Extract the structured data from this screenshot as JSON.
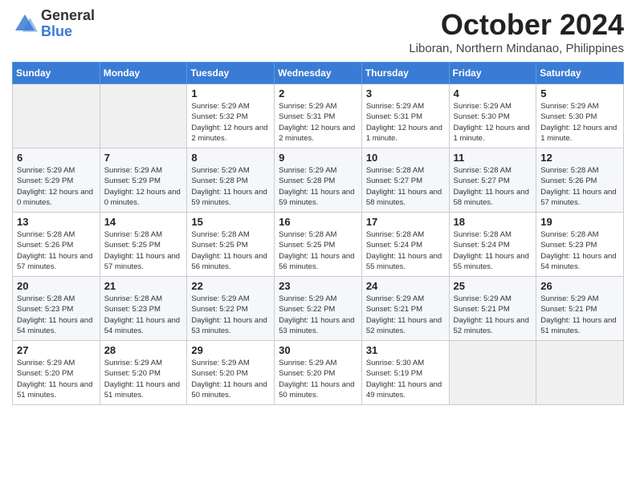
{
  "header": {
    "logo_general": "General",
    "logo_blue": "Blue",
    "month_title": "October 2024",
    "subtitle": "Liboran, Northern Mindanao, Philippines"
  },
  "days_of_week": [
    "Sunday",
    "Monday",
    "Tuesday",
    "Wednesday",
    "Thursday",
    "Friday",
    "Saturday"
  ],
  "weeks": [
    [
      {
        "day": "",
        "sunrise": "",
        "sunset": "",
        "daylight": ""
      },
      {
        "day": "",
        "sunrise": "",
        "sunset": "",
        "daylight": ""
      },
      {
        "day": "1",
        "sunrise": "Sunrise: 5:29 AM",
        "sunset": "Sunset: 5:32 PM",
        "daylight": "Daylight: 12 hours and 2 minutes."
      },
      {
        "day": "2",
        "sunrise": "Sunrise: 5:29 AM",
        "sunset": "Sunset: 5:31 PM",
        "daylight": "Daylight: 12 hours and 2 minutes."
      },
      {
        "day": "3",
        "sunrise": "Sunrise: 5:29 AM",
        "sunset": "Sunset: 5:31 PM",
        "daylight": "Daylight: 12 hours and 1 minute."
      },
      {
        "day": "4",
        "sunrise": "Sunrise: 5:29 AM",
        "sunset": "Sunset: 5:30 PM",
        "daylight": "Daylight: 12 hours and 1 minute."
      },
      {
        "day": "5",
        "sunrise": "Sunrise: 5:29 AM",
        "sunset": "Sunset: 5:30 PM",
        "daylight": "Daylight: 12 hours and 1 minute."
      }
    ],
    [
      {
        "day": "6",
        "sunrise": "Sunrise: 5:29 AM",
        "sunset": "Sunset: 5:29 PM",
        "daylight": "Daylight: 12 hours and 0 minutes."
      },
      {
        "day": "7",
        "sunrise": "Sunrise: 5:29 AM",
        "sunset": "Sunset: 5:29 PM",
        "daylight": "Daylight: 12 hours and 0 minutes."
      },
      {
        "day": "8",
        "sunrise": "Sunrise: 5:29 AM",
        "sunset": "Sunset: 5:28 PM",
        "daylight": "Daylight: 11 hours and 59 minutes."
      },
      {
        "day": "9",
        "sunrise": "Sunrise: 5:29 AM",
        "sunset": "Sunset: 5:28 PM",
        "daylight": "Daylight: 11 hours and 59 minutes."
      },
      {
        "day": "10",
        "sunrise": "Sunrise: 5:28 AM",
        "sunset": "Sunset: 5:27 PM",
        "daylight": "Daylight: 11 hours and 58 minutes."
      },
      {
        "day": "11",
        "sunrise": "Sunrise: 5:28 AM",
        "sunset": "Sunset: 5:27 PM",
        "daylight": "Daylight: 11 hours and 58 minutes."
      },
      {
        "day": "12",
        "sunrise": "Sunrise: 5:28 AM",
        "sunset": "Sunset: 5:26 PM",
        "daylight": "Daylight: 11 hours and 57 minutes."
      }
    ],
    [
      {
        "day": "13",
        "sunrise": "Sunrise: 5:28 AM",
        "sunset": "Sunset: 5:26 PM",
        "daylight": "Daylight: 11 hours and 57 minutes."
      },
      {
        "day": "14",
        "sunrise": "Sunrise: 5:28 AM",
        "sunset": "Sunset: 5:25 PM",
        "daylight": "Daylight: 11 hours and 57 minutes."
      },
      {
        "day": "15",
        "sunrise": "Sunrise: 5:28 AM",
        "sunset": "Sunset: 5:25 PM",
        "daylight": "Daylight: 11 hours and 56 minutes."
      },
      {
        "day": "16",
        "sunrise": "Sunrise: 5:28 AM",
        "sunset": "Sunset: 5:25 PM",
        "daylight": "Daylight: 11 hours and 56 minutes."
      },
      {
        "day": "17",
        "sunrise": "Sunrise: 5:28 AM",
        "sunset": "Sunset: 5:24 PM",
        "daylight": "Daylight: 11 hours and 55 minutes."
      },
      {
        "day": "18",
        "sunrise": "Sunrise: 5:28 AM",
        "sunset": "Sunset: 5:24 PM",
        "daylight": "Daylight: 11 hours and 55 minutes."
      },
      {
        "day": "19",
        "sunrise": "Sunrise: 5:28 AM",
        "sunset": "Sunset: 5:23 PM",
        "daylight": "Daylight: 11 hours and 54 minutes."
      }
    ],
    [
      {
        "day": "20",
        "sunrise": "Sunrise: 5:28 AM",
        "sunset": "Sunset: 5:23 PM",
        "daylight": "Daylight: 11 hours and 54 minutes."
      },
      {
        "day": "21",
        "sunrise": "Sunrise: 5:28 AM",
        "sunset": "Sunset: 5:23 PM",
        "daylight": "Daylight: 11 hours and 54 minutes."
      },
      {
        "day": "22",
        "sunrise": "Sunrise: 5:29 AM",
        "sunset": "Sunset: 5:22 PM",
        "daylight": "Daylight: 11 hours and 53 minutes."
      },
      {
        "day": "23",
        "sunrise": "Sunrise: 5:29 AM",
        "sunset": "Sunset: 5:22 PM",
        "daylight": "Daylight: 11 hours and 53 minutes."
      },
      {
        "day": "24",
        "sunrise": "Sunrise: 5:29 AM",
        "sunset": "Sunset: 5:21 PM",
        "daylight": "Daylight: 11 hours and 52 minutes."
      },
      {
        "day": "25",
        "sunrise": "Sunrise: 5:29 AM",
        "sunset": "Sunset: 5:21 PM",
        "daylight": "Daylight: 11 hours and 52 minutes."
      },
      {
        "day": "26",
        "sunrise": "Sunrise: 5:29 AM",
        "sunset": "Sunset: 5:21 PM",
        "daylight": "Daylight: 11 hours and 51 minutes."
      }
    ],
    [
      {
        "day": "27",
        "sunrise": "Sunrise: 5:29 AM",
        "sunset": "Sunset: 5:20 PM",
        "daylight": "Daylight: 11 hours and 51 minutes."
      },
      {
        "day": "28",
        "sunrise": "Sunrise: 5:29 AM",
        "sunset": "Sunset: 5:20 PM",
        "daylight": "Daylight: 11 hours and 51 minutes."
      },
      {
        "day": "29",
        "sunrise": "Sunrise: 5:29 AM",
        "sunset": "Sunset: 5:20 PM",
        "daylight": "Daylight: 11 hours and 50 minutes."
      },
      {
        "day": "30",
        "sunrise": "Sunrise: 5:29 AM",
        "sunset": "Sunset: 5:20 PM",
        "daylight": "Daylight: 11 hours and 50 minutes."
      },
      {
        "day": "31",
        "sunrise": "Sunrise: 5:30 AM",
        "sunset": "Sunset: 5:19 PM",
        "daylight": "Daylight: 11 hours and 49 minutes."
      },
      {
        "day": "",
        "sunrise": "",
        "sunset": "",
        "daylight": ""
      },
      {
        "day": "",
        "sunrise": "",
        "sunset": "",
        "daylight": ""
      }
    ]
  ]
}
